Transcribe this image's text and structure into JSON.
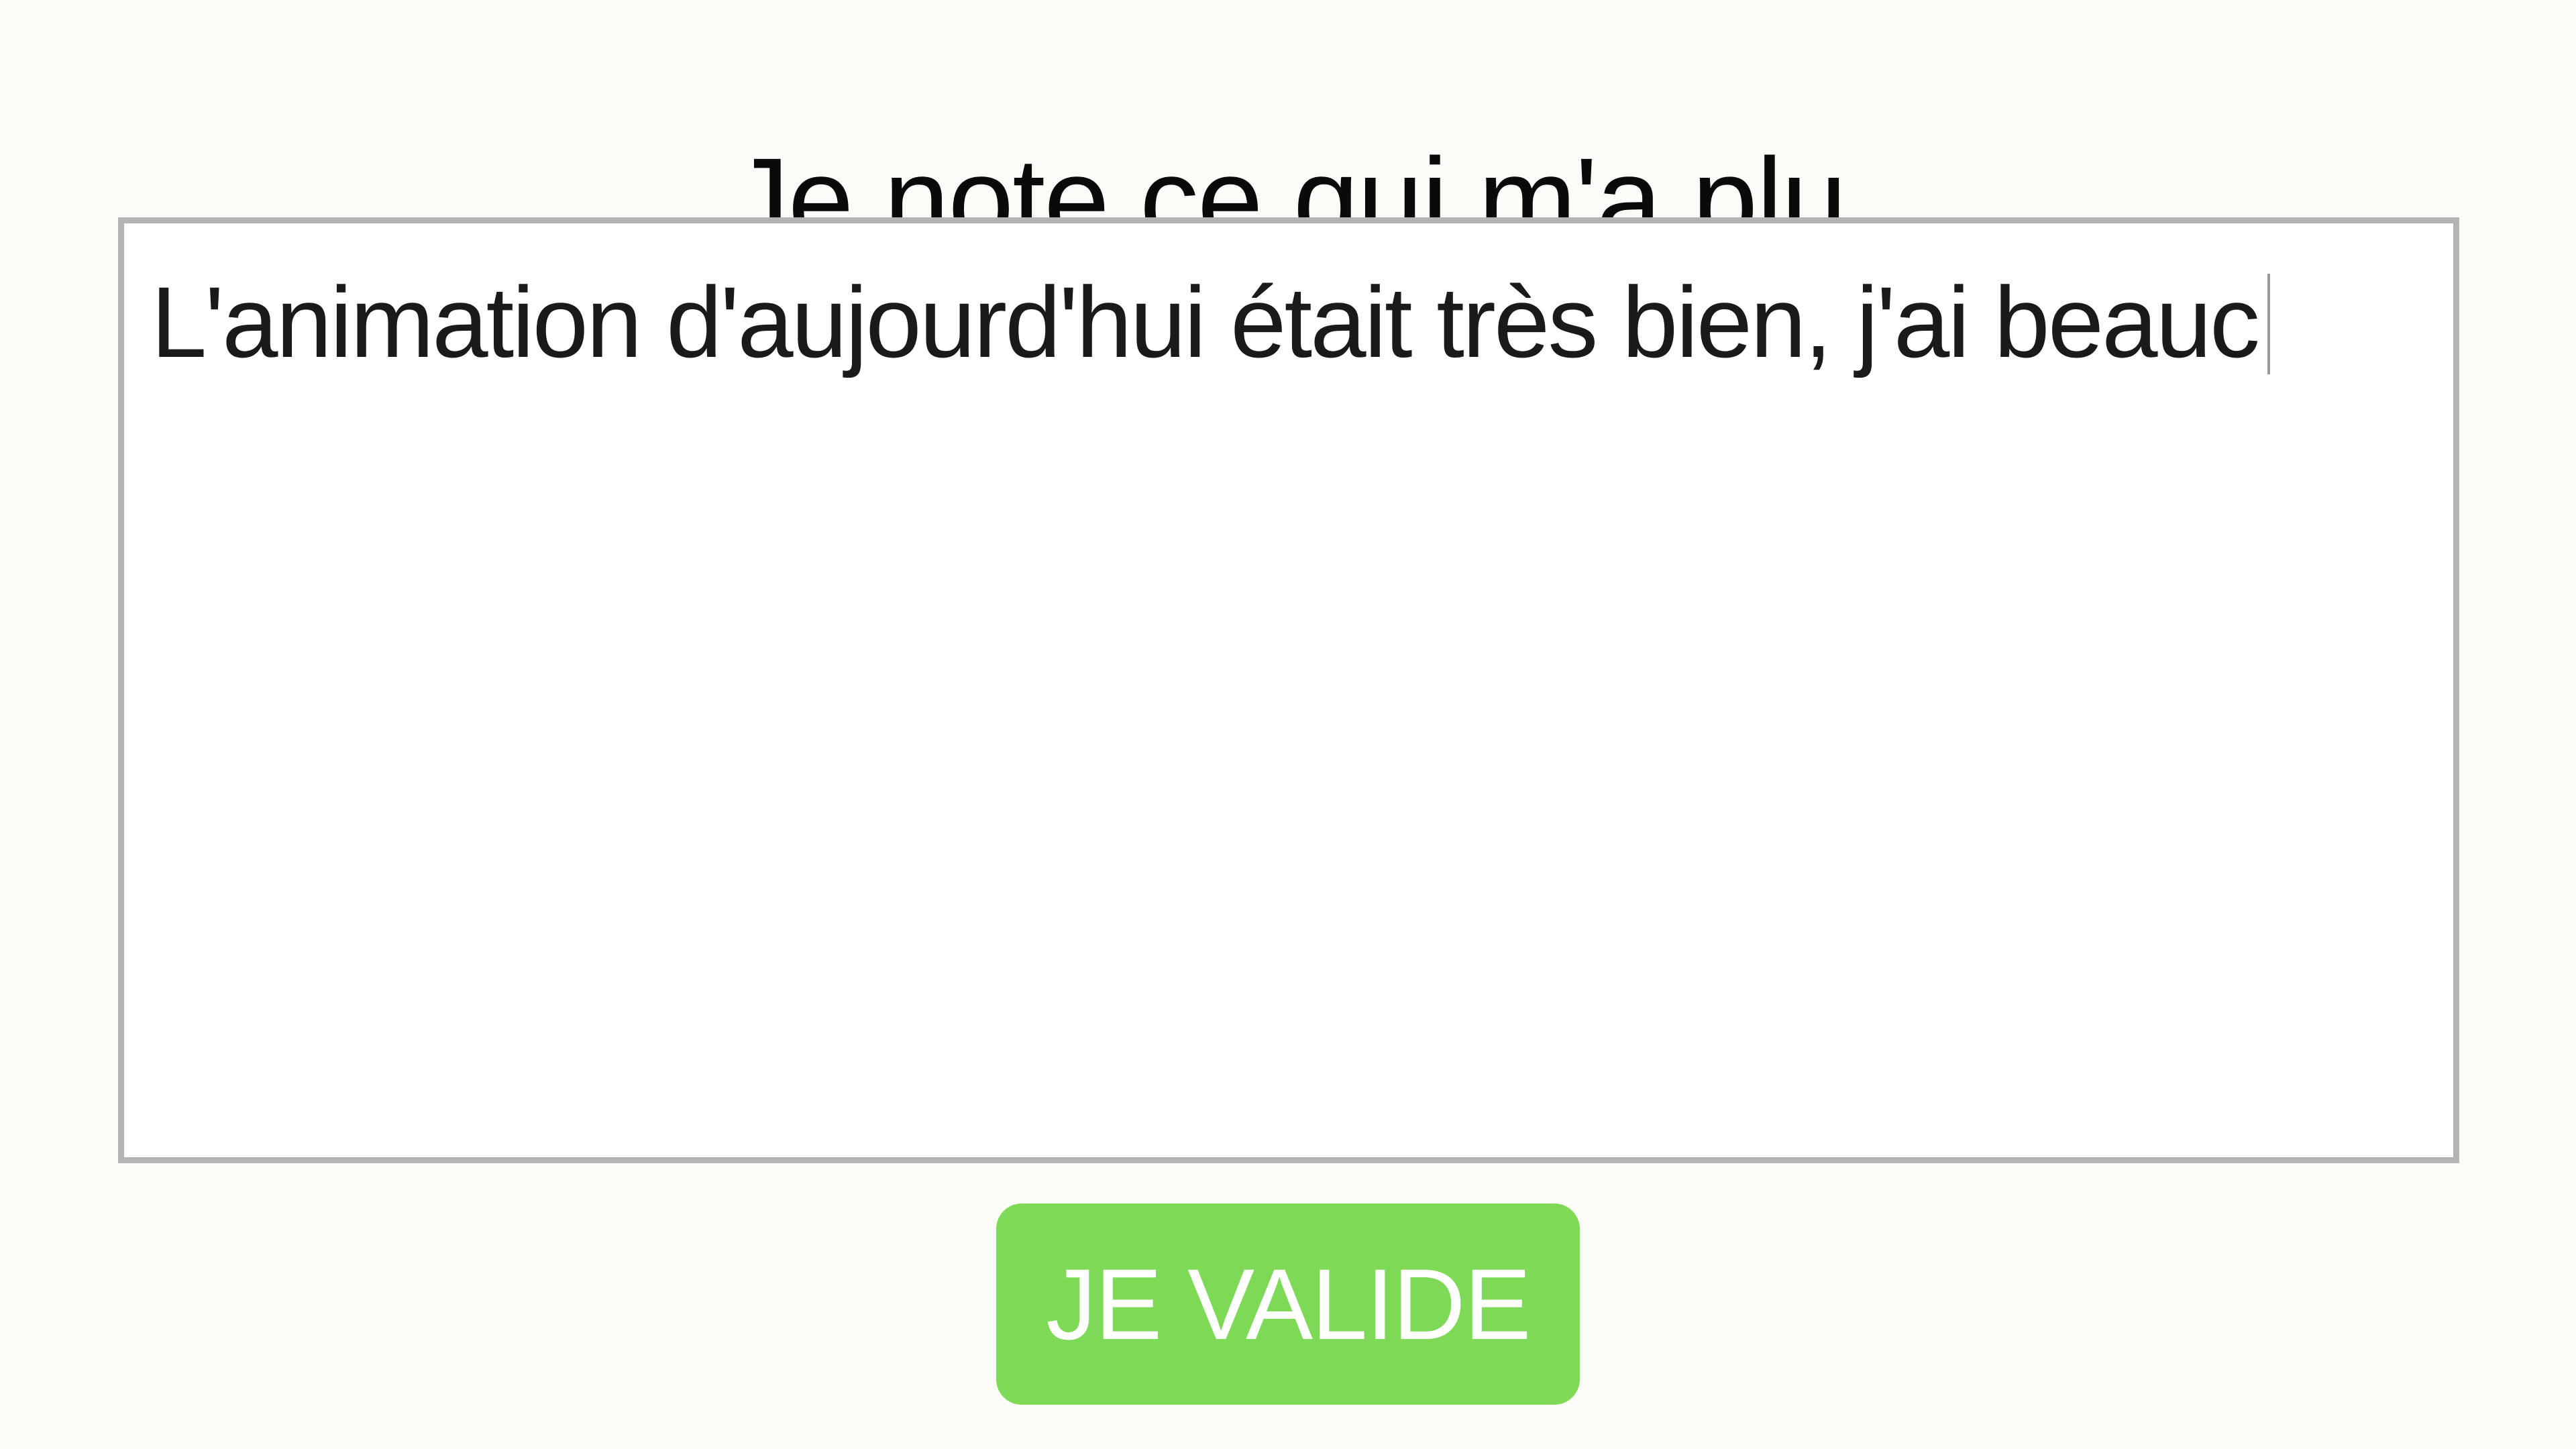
{
  "page": {
    "title": "Je note ce qui m'a plu"
  },
  "note": {
    "value": "L'animation d'aujourd'hui était très bien, j'ai beauc"
  },
  "actions": {
    "validate_label": "JE VALIDE"
  },
  "colors": {
    "background": "#fbfcf7",
    "button": "#7ed957",
    "box_border": "#b4b5b2"
  }
}
